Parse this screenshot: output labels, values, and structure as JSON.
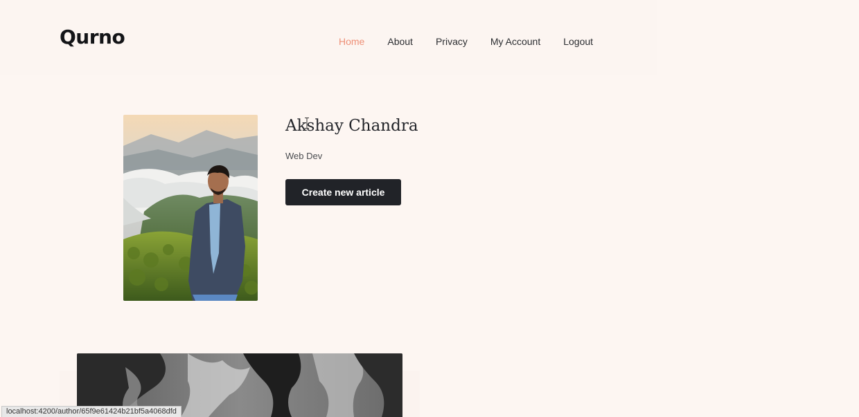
{
  "header": {
    "logo": "Qurno",
    "nav": [
      {
        "label": "Home",
        "active": true
      },
      {
        "label": "About",
        "active": false
      },
      {
        "label": "Privacy",
        "active": false
      },
      {
        "label": "My Account",
        "active": false
      },
      {
        "label": "Logout",
        "active": false
      }
    ]
  },
  "profile": {
    "name": "Akshay Chandra",
    "role": "Web Dev",
    "create_button_label": "Create new article",
    "photo_alt": "profile photo"
  },
  "status_bar": {
    "url": "localhost:4200/author/65f9e61424b21bf5a4068dfd"
  },
  "colors": {
    "background": "#fdf6f2",
    "nav_active": "#ee8f76",
    "button_bg": "#212328"
  }
}
